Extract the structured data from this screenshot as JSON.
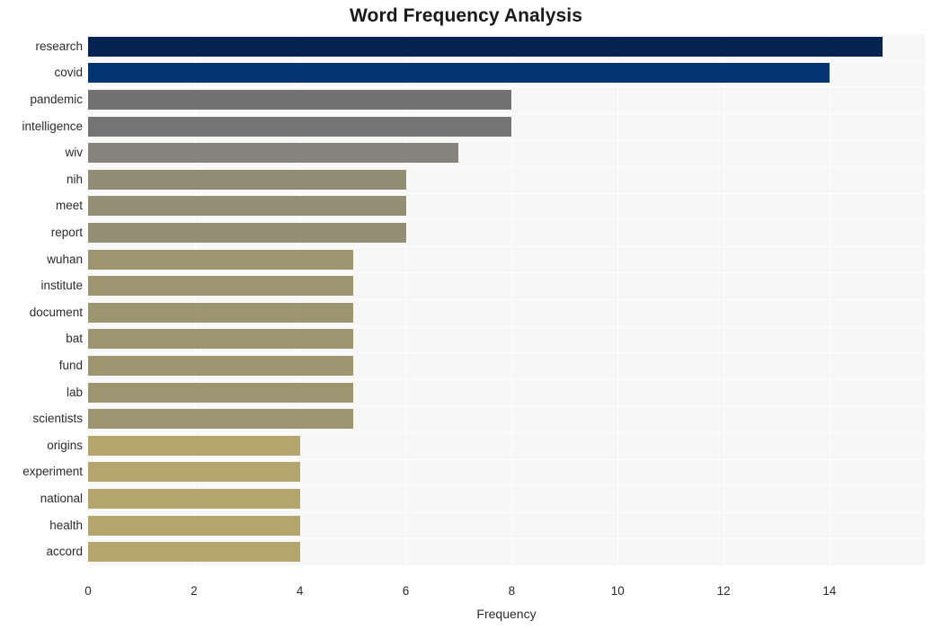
{
  "chart_data": {
    "type": "bar",
    "orientation": "horizontal",
    "title": "Word Frequency Analysis",
    "xlabel": "Frequency",
    "ylabel": "",
    "categories": [
      "research",
      "covid",
      "pandemic",
      "intelligence",
      "wiv",
      "nih",
      "meet",
      "report",
      "wuhan",
      "institute",
      "document",
      "bat",
      "fund",
      "lab",
      "scientists",
      "origins",
      "experiment",
      "national",
      "health",
      "accord"
    ],
    "values": [
      15,
      14,
      8,
      8,
      7,
      6,
      6,
      6,
      5,
      5,
      5,
      5,
      5,
      5,
      5,
      4,
      4,
      4,
      4,
      4
    ],
    "bar_colors": [
      "#042350",
      "#043570",
      "#727272",
      "#747474",
      "#85837c",
      "#918d75",
      "#948f74",
      "#948f74",
      "#9c9570",
      "#9c9570",
      "#9c9570",
      "#9c9570",
      "#9c9570",
      "#9c9570",
      "#9c9570",
      "#b3a56b",
      "#b3a56b",
      "#b3a56b",
      "#b3a56b",
      "#b3a56b"
    ],
    "xlim": [
      0,
      15.8
    ],
    "x_ticks": [
      "0",
      "2",
      "4",
      "6",
      "8",
      "10",
      "12",
      "14"
    ],
    "x_tick_values": [
      0,
      2,
      4,
      6,
      8,
      10,
      12,
      14
    ],
    "grid": true,
    "grid_color": "#ffffff",
    "plot_background": "#f7f7f7",
    "legend": null
  }
}
